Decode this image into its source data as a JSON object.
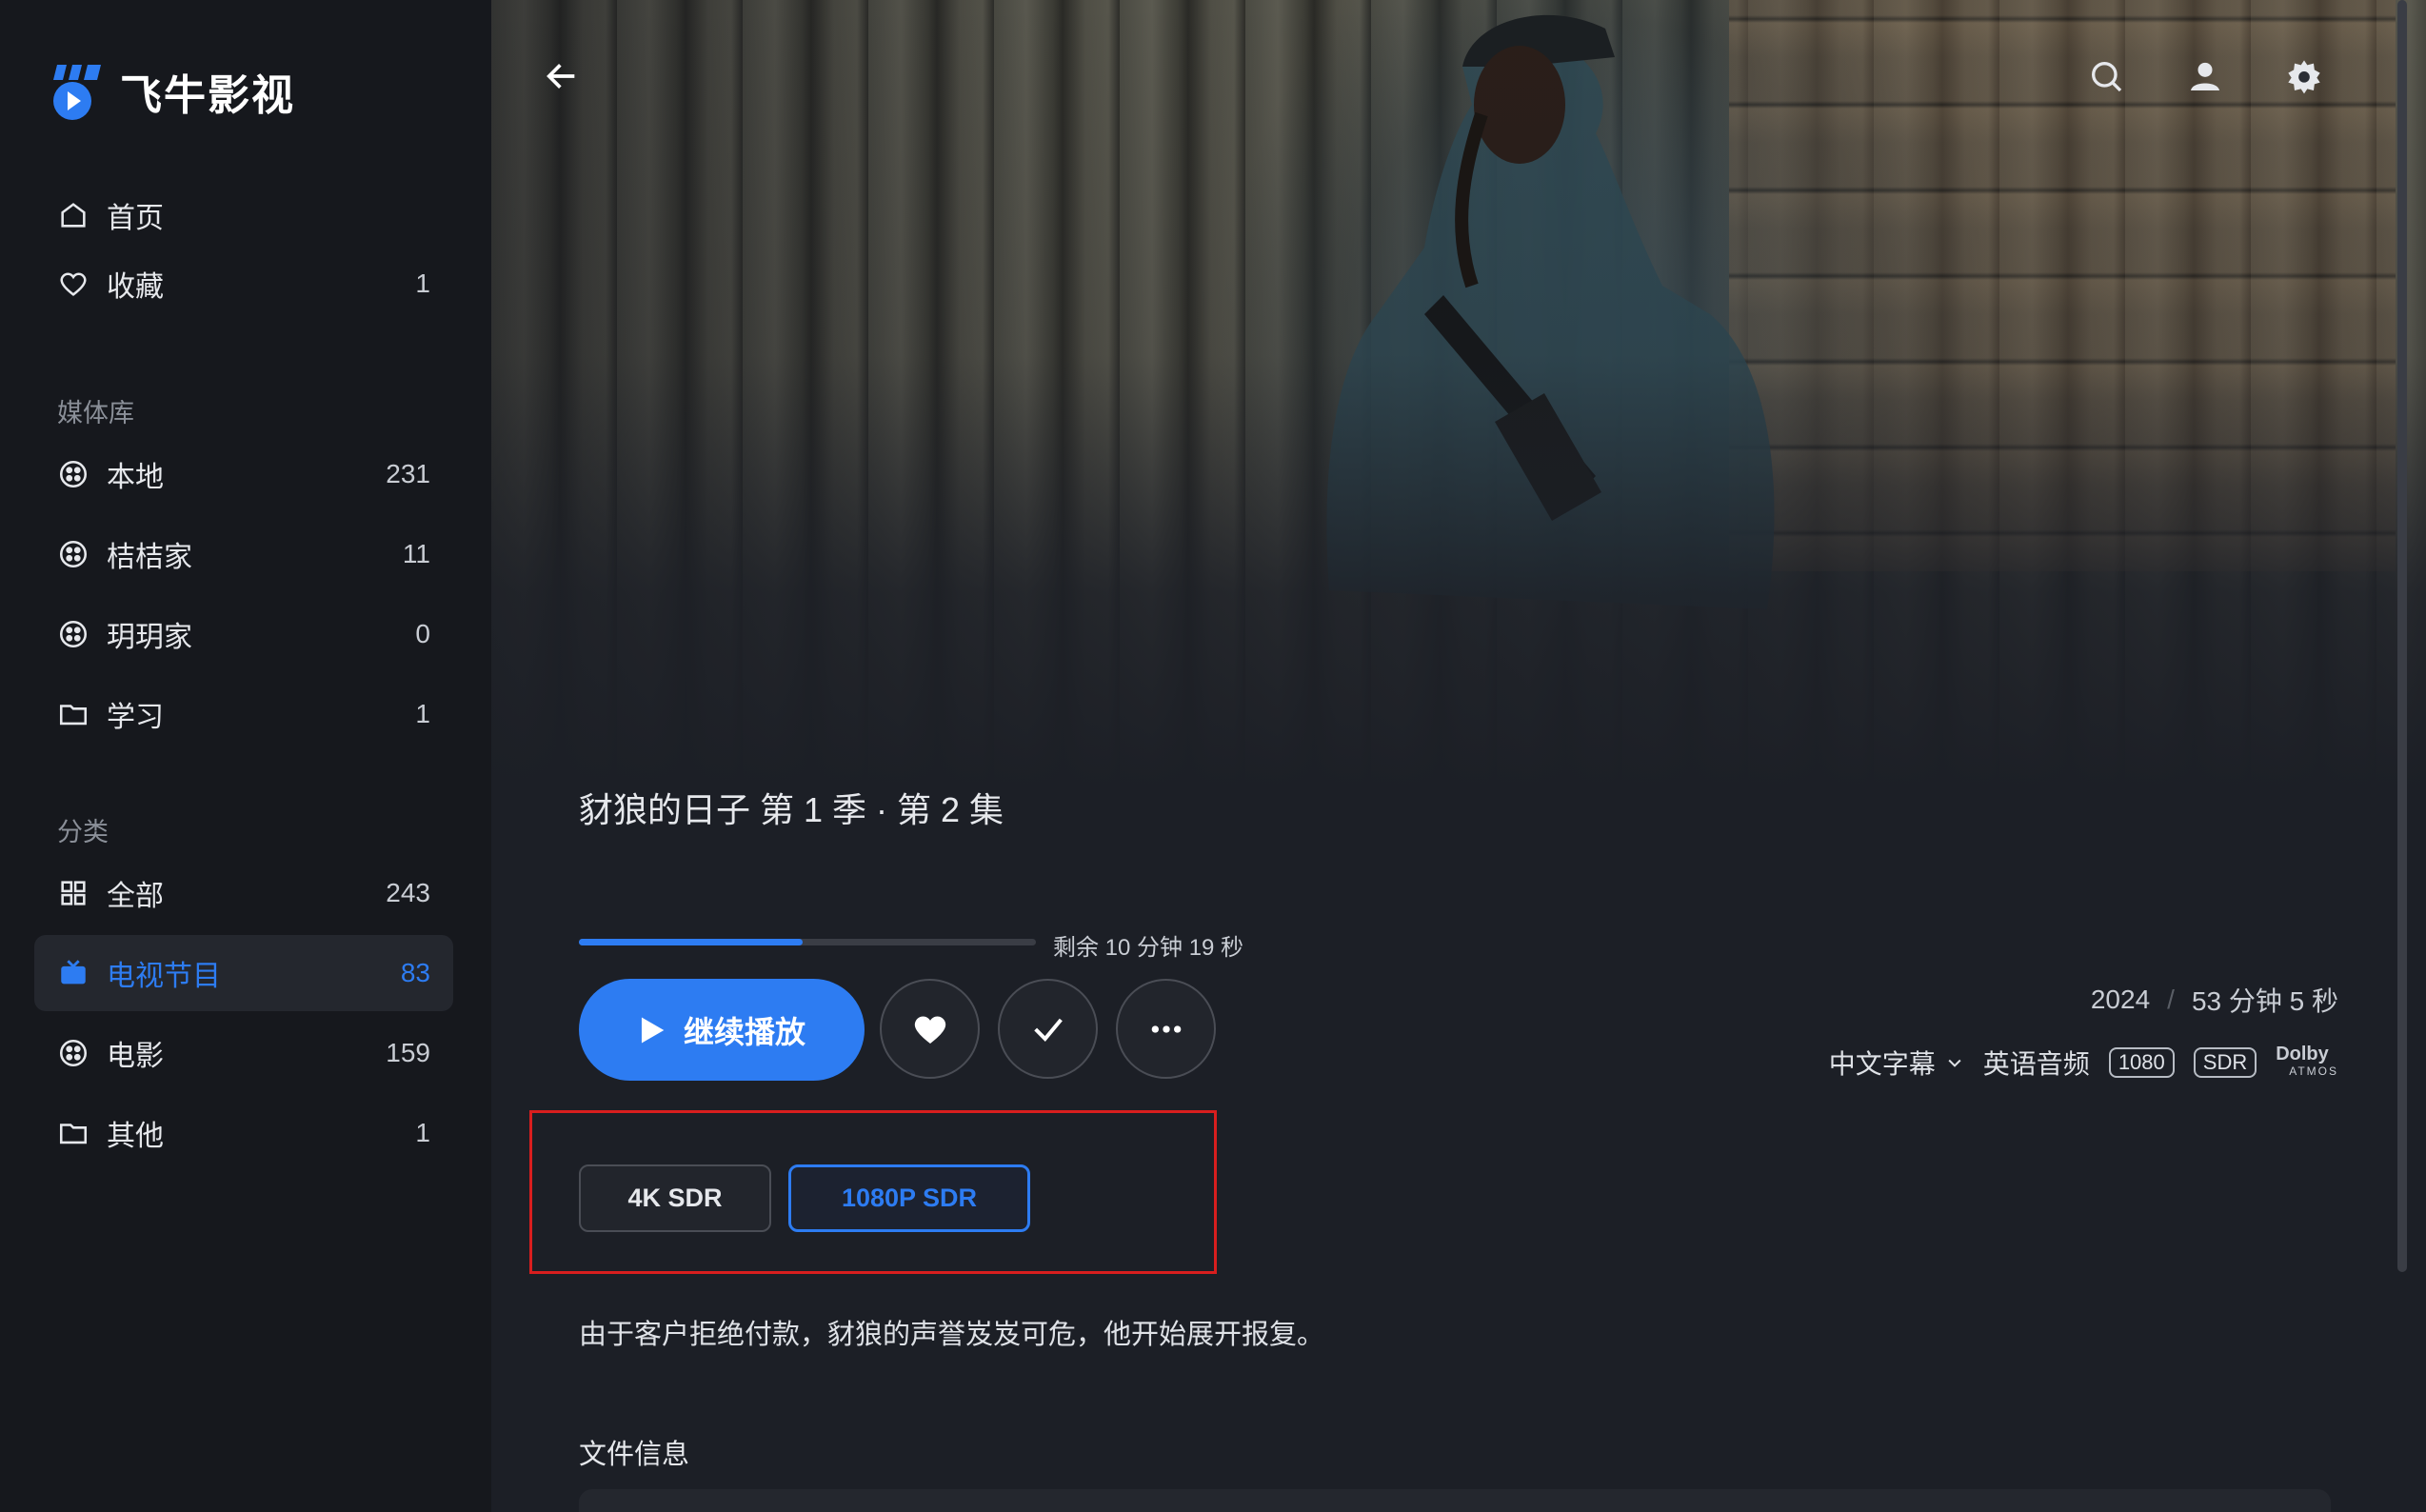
{
  "app": {
    "name": "飞牛影视",
    "accent": "#2d7cf2"
  },
  "sidebar": {
    "top_items": [
      {
        "label": "首页",
        "icon": "home-icon"
      },
      {
        "label": "收藏",
        "icon": "heart-icon",
        "count": "1"
      }
    ],
    "library_title": "媒体库",
    "library_items": [
      {
        "label": "本地",
        "icon": "library-icon",
        "count": "231"
      },
      {
        "label": "桔桔家",
        "icon": "library-icon",
        "count": "11"
      },
      {
        "label": "玥玥家",
        "icon": "library-icon",
        "count": "0"
      },
      {
        "label": "学习",
        "icon": "folder-icon",
        "count": "1"
      }
    ],
    "category_title": "分类",
    "category_items": [
      {
        "label": "全部",
        "icon": "grid-icon",
        "count": "243"
      },
      {
        "label": "电视节目",
        "icon": "tv-icon",
        "count": "83",
        "active": true
      },
      {
        "label": "电影",
        "icon": "film-reel-icon",
        "count": "159"
      },
      {
        "label": "其他",
        "icon": "folder-icon",
        "count": "1"
      }
    ]
  },
  "header": {
    "icons": [
      "back-arrow-icon",
      "search-icon",
      "user-icon",
      "settings-icon"
    ]
  },
  "episode": {
    "title": "豺狼的日子 第 1 季 · 第 2 集",
    "progress_fraction": 0.49,
    "remaining_text": "剩余 10 分钟 19 秒",
    "play_label": "继续播放",
    "year": "2024",
    "separator": "/",
    "duration": "53 分钟 5 秒",
    "subtitle": "中文字幕",
    "audio": "英语音频",
    "badges": [
      "1080",
      "SDR"
    ],
    "dolby_line1": "Dolby",
    "dolby_line2": "ATMOS",
    "versions": [
      "4K SDR",
      "1080P SDR"
    ],
    "selected_version": "1080P SDR",
    "description": "由于客户拒绝付款，豺狼的声誉岌岌可危，他开始展开报复。",
    "file_info_title": "文件信息"
  },
  "colors": {
    "highlight_box": "#d81e1e",
    "background": "#1c1f26",
    "sidebar_bg": "#16181d"
  }
}
